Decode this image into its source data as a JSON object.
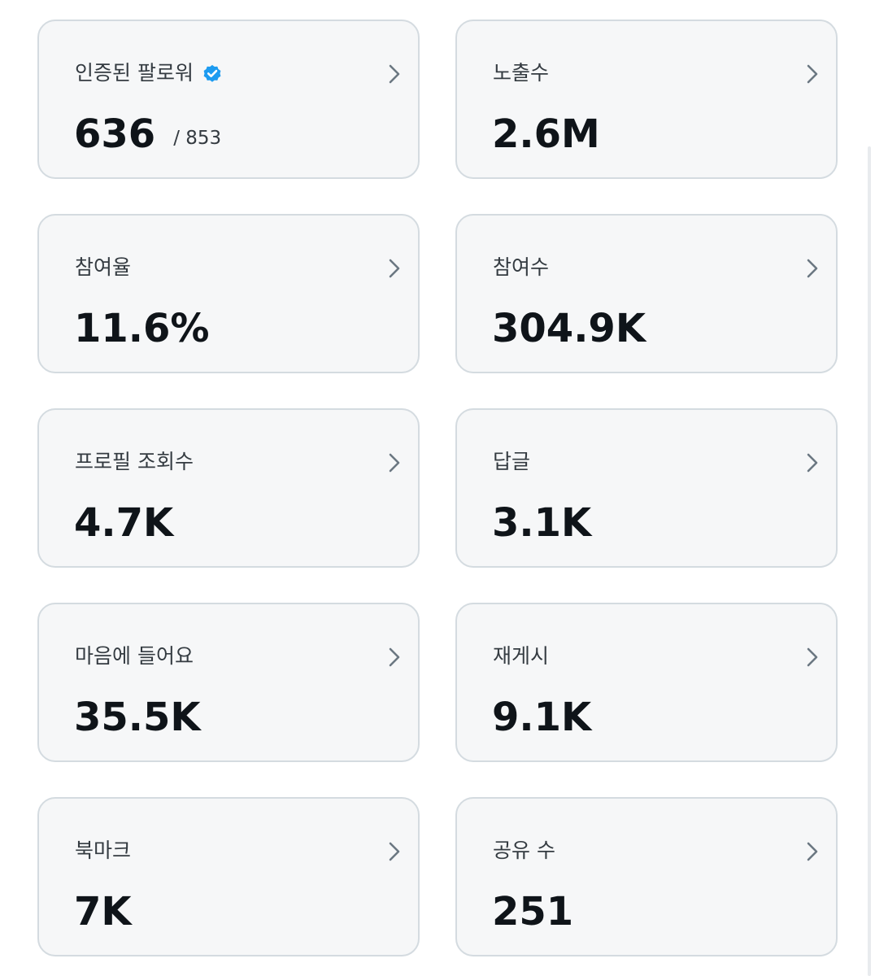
{
  "colors": {
    "card_background": "#f6f7f8",
    "card_border": "#d4dbe0",
    "title_text": "#343b41",
    "value_text": "#0f1419",
    "chevron": "#6b7782",
    "verified_badge": "#1d9bf0"
  },
  "icons": {
    "verified": "verified-badge-icon",
    "chevron": "chevron-right-icon"
  },
  "metrics": [
    {
      "title": "인증된 팔로워",
      "value": "636",
      "sub": "/ 853"
    },
    {
      "title": "노출수",
      "value": "2.6M"
    },
    {
      "title": "참여율",
      "value": "11.6%"
    },
    {
      "title": "참여수",
      "value": "304.9K"
    },
    {
      "title": "프로필 조회수",
      "value": "4.7K"
    },
    {
      "title": "답글",
      "value": "3.1K"
    },
    {
      "title": "마음에 들어요",
      "value": "35.5K"
    },
    {
      "title": "재게시",
      "value": "9.1K"
    },
    {
      "title": "북마크",
      "value": "7K"
    },
    {
      "title": "공유 수",
      "value": "251"
    }
  ]
}
